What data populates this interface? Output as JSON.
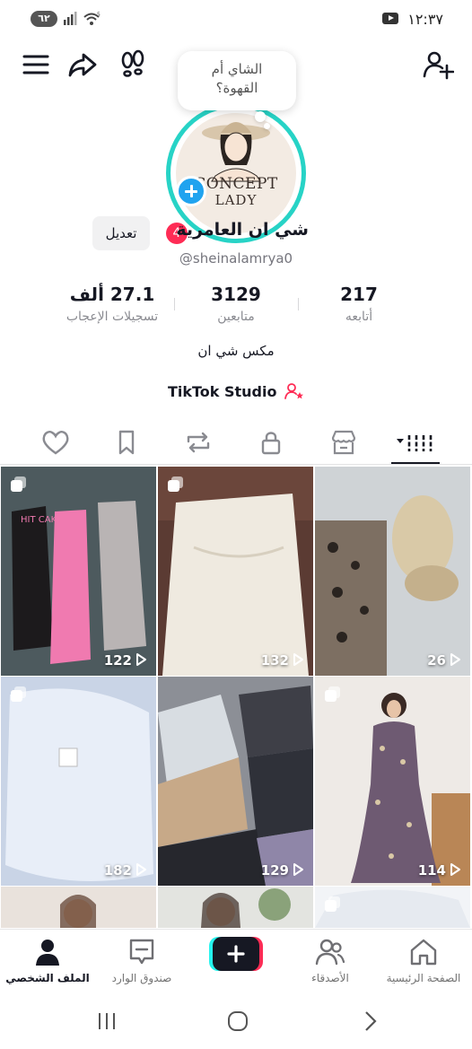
{
  "status_bar": {
    "time": "١٢:٣٧",
    "battery": "٦٢",
    "wifi_label": "5"
  },
  "top_nav": {
    "icons": [
      "menu-icon",
      "share-icon",
      "footprint-icon",
      "add-friend-icon"
    ]
  },
  "profile": {
    "note_line1": "الشاي أم",
    "note_line2": "القهوة؟",
    "avatar_brand_line1": "CONCEPT",
    "avatar_brand_line2": "LADY",
    "display_name": "شي ان العامرية",
    "notification_count": "4",
    "username": "@sheinalamrya0",
    "edit_label": "تعديل",
    "bio": "مكس شي ان",
    "studio_label": "TikTok Studio"
  },
  "stats": {
    "following_count": "217",
    "following_label": "أتابعه",
    "followers_count": "3129",
    "followers_label": "متابعين",
    "likes_count": "27.1 ألف",
    "likes_label": "تسجيلات الإعجاب"
  },
  "tabs": [
    "videos-tab",
    "shop-tab",
    "private-tab",
    "reposts-tab",
    "favorites-tab",
    "liked-tab"
  ],
  "videos": [
    {
      "views": "122",
      "theme": "sweatpants"
    },
    {
      "views": "132",
      "theme": "white-dress"
    },
    {
      "views": "26",
      "theme": "sandals"
    },
    {
      "views": "182",
      "theme": "white-bag"
    },
    {
      "views": "129",
      "theme": "clothes-pile"
    },
    {
      "views": "114",
      "theme": "floral-dress"
    },
    {
      "views": "",
      "theme": "model-1"
    },
    {
      "views": "",
      "theme": "model-2"
    },
    {
      "views": "",
      "theme": "white-fabric"
    }
  ],
  "bottom_nav": {
    "home": "الصفحة الرئيسية",
    "friends": "الأصدقاء",
    "inbox": "صندوق الوارد",
    "profile": "الملف الشخصي"
  },
  "colors": {
    "accent_pink": "#fe2c55",
    "accent_cyan": "#27d3c6",
    "add_blue": "#20a3ef"
  }
}
